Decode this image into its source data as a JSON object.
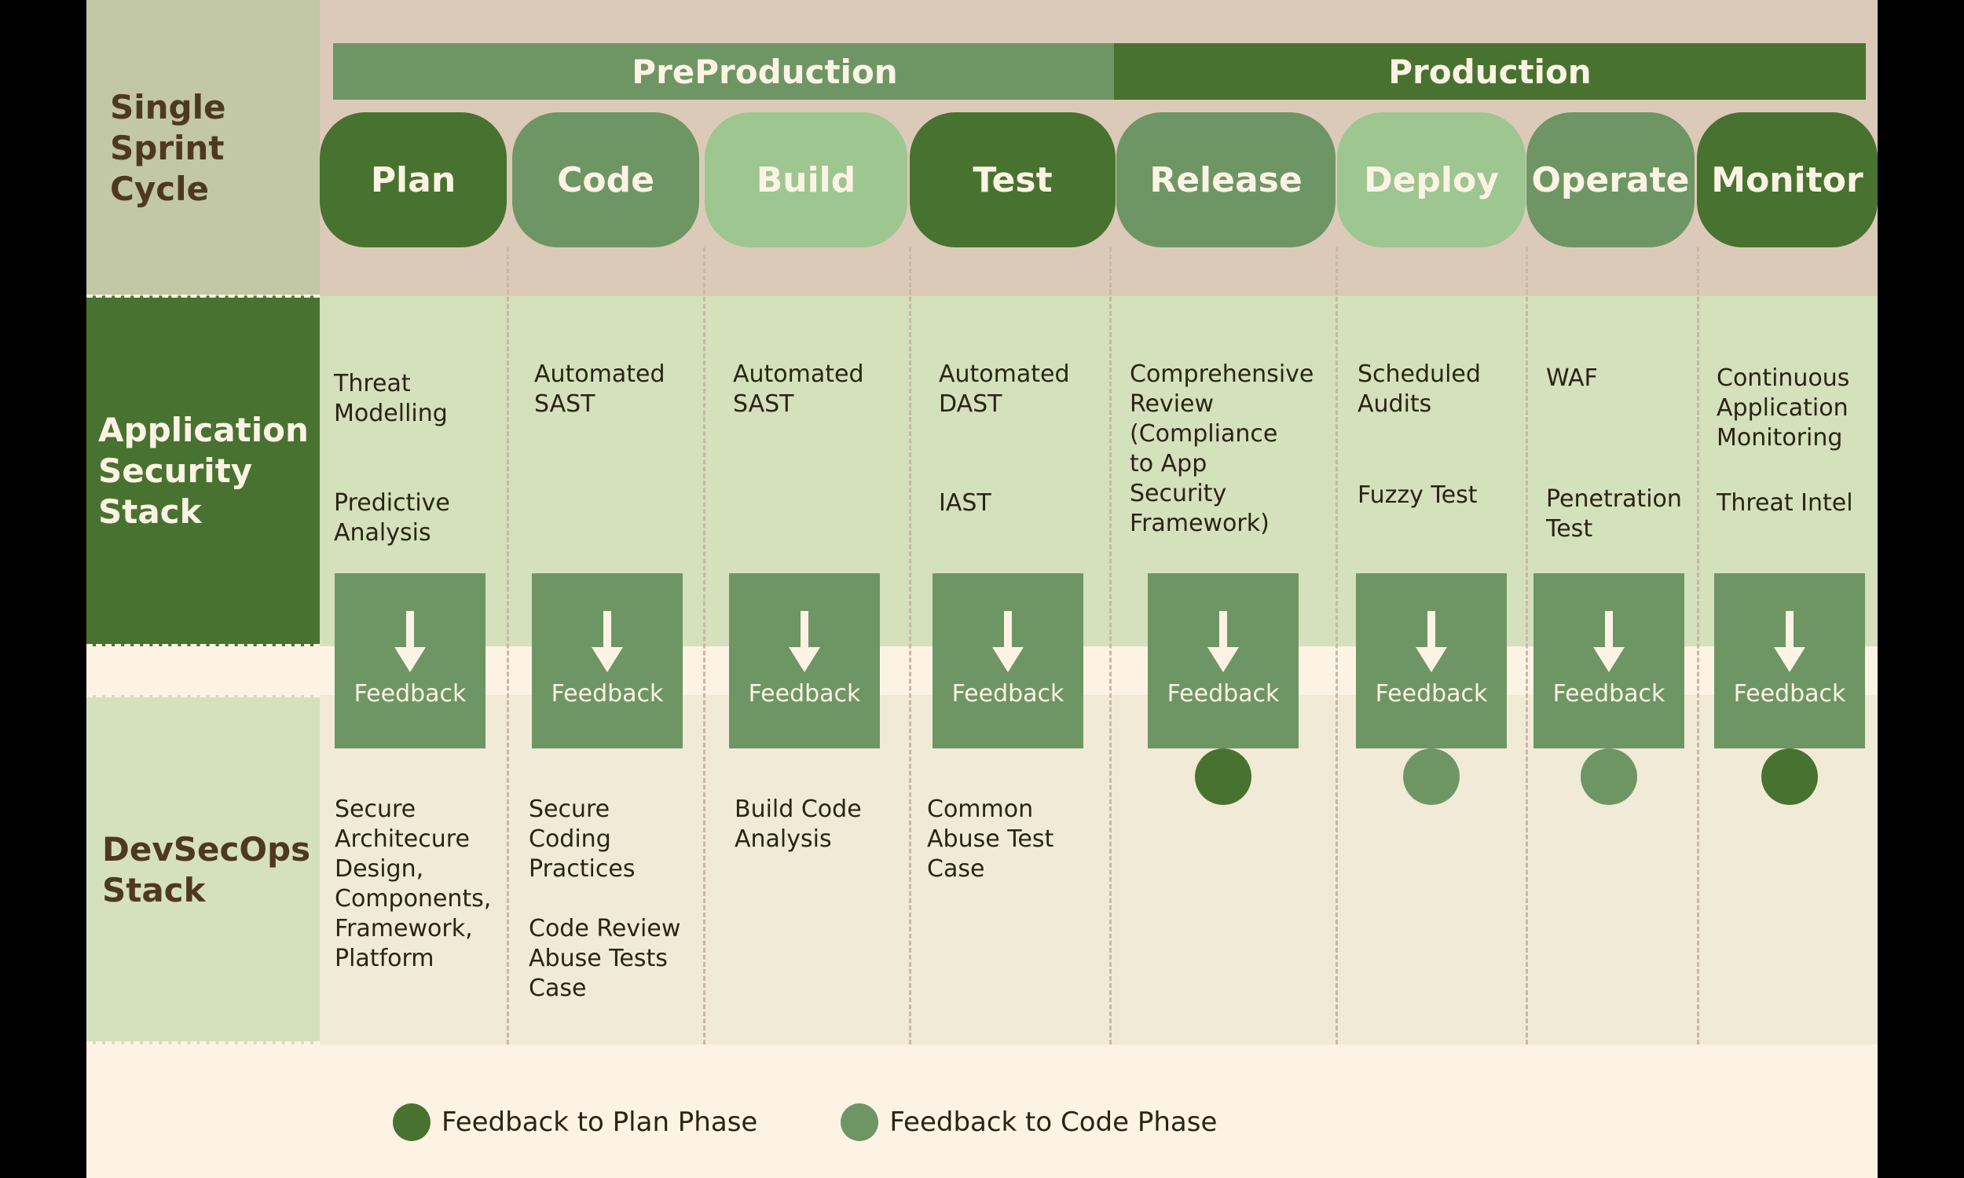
{
  "colors": {
    "dark_green": "#487230",
    "mid_green": "#6e9664",
    "light_green": "#9dc690",
    "cream_text": "#fdf3e5",
    "brown_text": "#4f3820"
  },
  "row_labels": {
    "sprint": "Single\nSprint\nCycle",
    "app_security": "Application\nSecurity\nStack",
    "devsecops": "DevSecOps\nStack"
  },
  "stages": {
    "preproduction": "PreProduction",
    "production": "Production"
  },
  "phases": [
    {
      "label": "Plan",
      "color": "#487230"
    },
    {
      "label": "Code",
      "color": "#6e9664"
    },
    {
      "label": "Build",
      "color": "#9dc690"
    },
    {
      "label": "Test",
      "color": "#487230"
    },
    {
      "label": "Release",
      "color": "#6e9664"
    },
    {
      "label": "Deploy",
      "color": "#9dc690"
    },
    {
      "label": "Operate",
      "color": "#6e9664"
    },
    {
      "label": "Monitor",
      "color": "#487230"
    }
  ],
  "app_security": [
    {
      "top": "Threat\nModelling",
      "bottom": "Predictive\nAnalysis"
    },
    {
      "top": "Automated\nSAST",
      "bottom": ""
    },
    {
      "top": "Automated\nSAST",
      "bottom": ""
    },
    {
      "top": "Automated\nDAST",
      "bottom": "IAST"
    },
    {
      "top": "Comprehensive\nReview\n(Compliance\n to App\n Security\n Framework)",
      "bottom": ""
    },
    {
      "top": "Scheduled\nAudits",
      "bottom": "Fuzzy Test"
    },
    {
      "top": "WAF",
      "bottom": "Penetration\nTest"
    },
    {
      "top": "Continuous\nApplication\nMonitoring",
      "bottom": "Threat Intel"
    }
  ],
  "feedback": {
    "label": "Feedback",
    "targets": [
      "none",
      "none",
      "none",
      "none",
      "plan",
      "code",
      "code",
      "plan"
    ]
  },
  "devsecops": [
    {
      "text": "Secure\nArchitecure\nDesign,\nComponents,\nFramework,\nPlatform"
    },
    {
      "text": "Secure\nCoding\nPractices\n\nCode Review\nAbuse Tests\nCase"
    },
    {
      "text": "Build Code\nAnalysis"
    },
    {
      "text": "Common\nAbuse Test\nCase"
    },
    {
      "text": ""
    },
    {
      "text": ""
    },
    {
      "text": ""
    },
    {
      "text": ""
    }
  ],
  "legend": [
    {
      "label": "Feedback to Plan Phase",
      "color": "#487230"
    },
    {
      "label": "Feedback to Code Phase",
      "color": "#6e9664"
    }
  ]
}
